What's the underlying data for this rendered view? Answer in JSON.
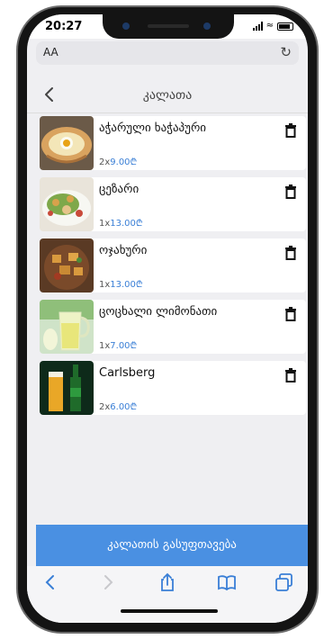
{
  "status_bar": {
    "time": "20:27"
  },
  "browser": {
    "address_label": "AA",
    "reload_icon": "reload-icon"
  },
  "header": {
    "title": "კალათა",
    "back_icon": "chevron-left-icon"
  },
  "cart": {
    "items": [
      {
        "name": "აჭარული ხაჭაპური",
        "qty": "2x",
        "price": "9.00₾",
        "thumb": "khachapuri",
        "delete_icon": "trash-icon"
      },
      {
        "name": "ცეზარი",
        "qty": "1x",
        "price": "13.00₾",
        "thumb": "caesar-salad",
        "delete_icon": "trash-icon"
      },
      {
        "name": "ოჯახური",
        "qty": "1x",
        "price": "13.00₾",
        "thumb": "ojakhuri",
        "delete_icon": "trash-icon"
      },
      {
        "name": "ცოცხალი ლიმონათი",
        "qty": "1x",
        "price": "7.00₾",
        "thumb": "lemonade",
        "delete_icon": "trash-icon"
      },
      {
        "name": "Carlsberg",
        "qty": "2x",
        "price": "6.00₾",
        "thumb": "beer",
        "delete_icon": "trash-icon"
      }
    ]
  },
  "checkout": {
    "label": "კალათის გასუფთავება"
  },
  "toolbar": {
    "icons": [
      "back-arrow-icon",
      "forward-arrow-icon",
      "share-icon",
      "bookmarks-icon",
      "tabs-icon"
    ]
  },
  "colors": {
    "accent": "#4a90e2",
    "price": "#3a7fd6"
  }
}
